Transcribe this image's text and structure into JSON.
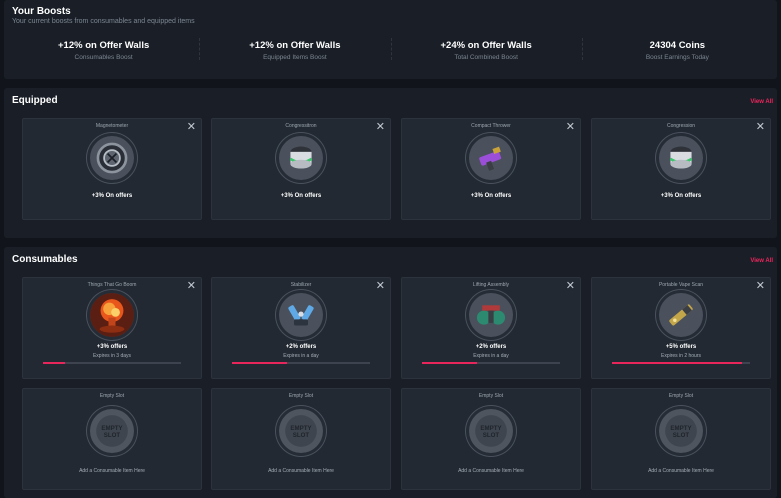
{
  "boosts": {
    "title": "Your Boosts",
    "subtitle": "Your current boosts from consumables and equipped items",
    "stats": [
      {
        "value": "+12% on Offer Walls",
        "label": "Consumables Boost"
      },
      {
        "value": "+12% on Offer Walls",
        "label": "Equipped Items Boost"
      },
      {
        "value": "+24% on Offer Walls",
        "label": "Total Combined Boost"
      },
      {
        "value": "24304 Coins",
        "label": "Boost Earnings Today"
      }
    ]
  },
  "equipped": {
    "title": "Equipped",
    "view_all": "View All",
    "items": [
      {
        "name": "Magnetometer",
        "effect": "+3% On offers",
        "icon": "magnetometer-icon"
      },
      {
        "name": "Congressitron",
        "effect": "+3% On offers",
        "icon": "congressitron-icon"
      },
      {
        "name": "Compact Thrower",
        "effect": "+3% On offers",
        "icon": "compact-thrower-icon"
      },
      {
        "name": "Congression",
        "effect": "+3% On offers",
        "icon": "congression-icon"
      }
    ]
  },
  "consumables": {
    "title": "Consumables",
    "view_all": "View All",
    "items": [
      {
        "name": "Things That Go Boom",
        "effect": "+3% offers",
        "expiry": "Expires in 3 days",
        "progress": 0.16,
        "icon": "explosion-icon"
      },
      {
        "name": "Stabilizer",
        "effect": "+2% offers",
        "expiry": "Expires in a day",
        "progress": 0.4,
        "icon": "stabilizer-icon"
      },
      {
        "name": "Lifting Assembly",
        "effect": "+2% offers",
        "expiry": "Expires in a day",
        "progress": 0.4,
        "icon": "lifting-assembly-icon"
      },
      {
        "name": "Portable Vape Scan",
        "effect": "+5% offers",
        "expiry": "Expires in 2 hours",
        "progress": 0.94,
        "icon": "vape-scan-icon"
      }
    ],
    "empty_slots": [
      {
        "name": "Empty Slot",
        "badge_line1": "EMPTY",
        "badge_line2": "SLOT",
        "text": "Add a Consumable Item Here"
      },
      {
        "name": "Empty Slot",
        "badge_line1": "EMPTY",
        "badge_line2": "SLOT",
        "text": "Add a Consumable Item Here"
      },
      {
        "name": "Empty Slot",
        "badge_line1": "EMPTY",
        "badge_line2": "SLOT",
        "text": "Add a Consumable Item Here"
      },
      {
        "name": "Empty Slot",
        "badge_line1": "EMPTY",
        "badge_line2": "SLOT",
        "text": "Add a Consumable Item Here"
      }
    ],
    "close_symbol": "✕"
  },
  "colors": {
    "accent": "#f0245c",
    "progress": "#e8265b",
    "panel": "#1a1f27",
    "card": "#222932"
  }
}
